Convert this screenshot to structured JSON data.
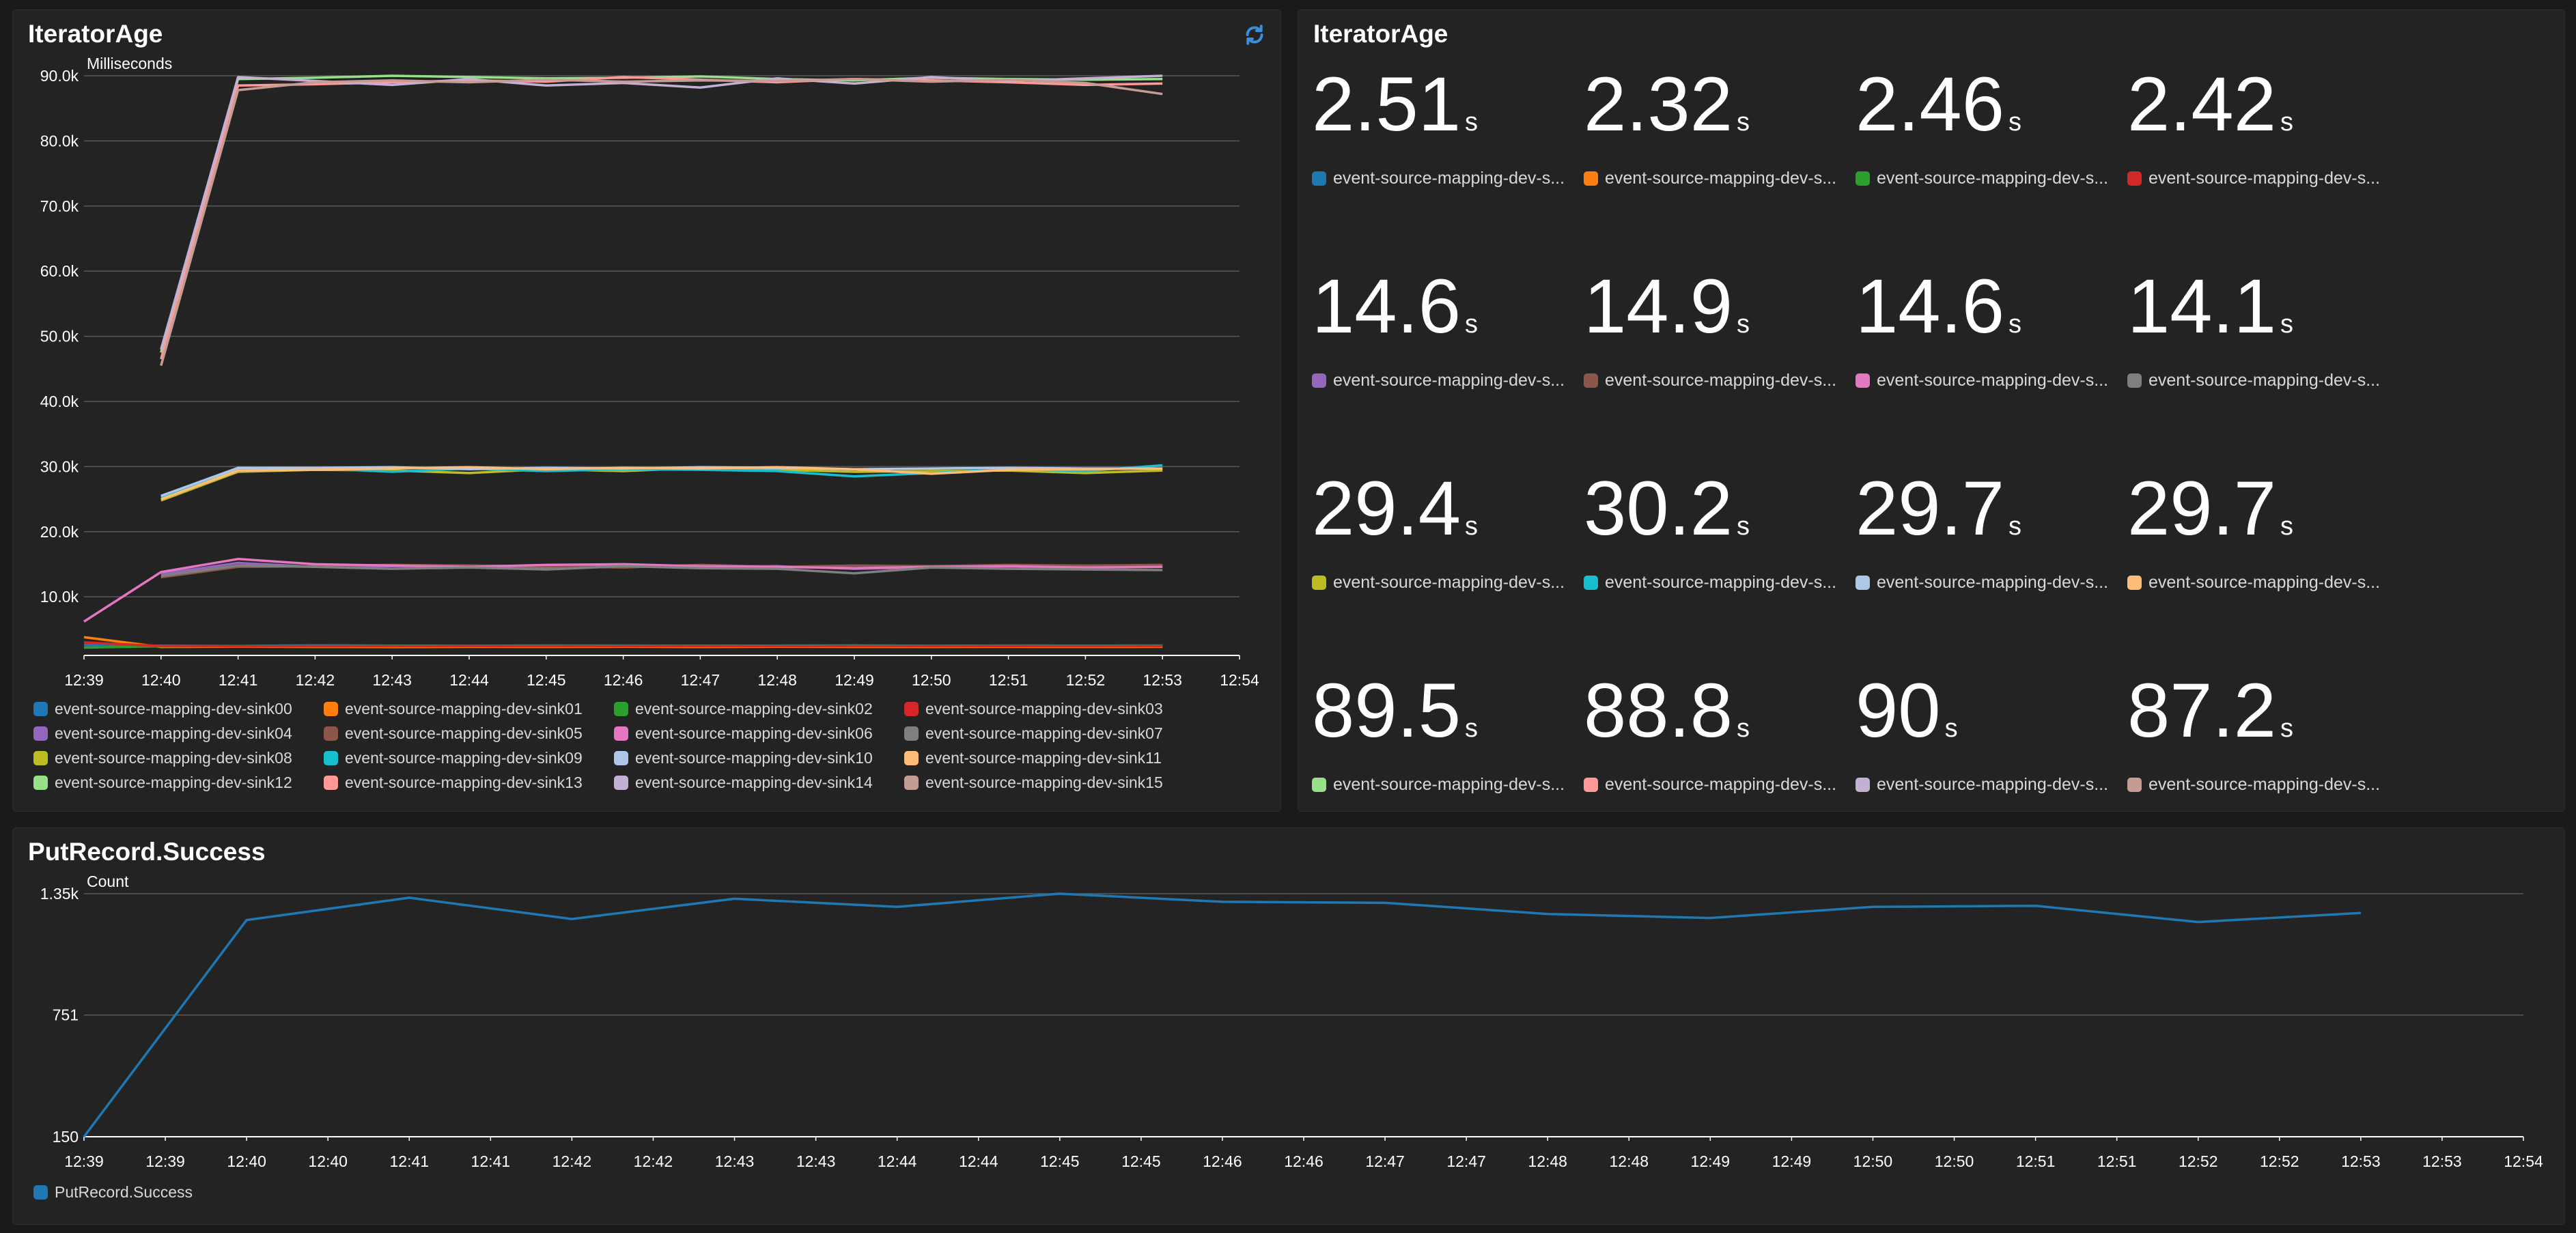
{
  "panels": {
    "iterator_chart": {
      "title": "IteratorAge",
      "refresh_icon": "refresh-icon"
    },
    "iterator_values": {
      "title": "IteratorAge"
    },
    "putrecord": {
      "title": "PutRecord.Success"
    }
  },
  "colors": {
    "background": "#1a1a1a",
    "panel": "#232323",
    "grid": "#5a5a5a",
    "accent": "#1f77b4"
  },
  "single_values": [
    {
      "value": "2.51",
      "unit": "s",
      "label": "event-source-mapping-dev-s...",
      "color": "#1f77b4"
    },
    {
      "value": "2.32",
      "unit": "s",
      "label": "event-source-mapping-dev-s...",
      "color": "#ff7f0e"
    },
    {
      "value": "2.46",
      "unit": "s",
      "label": "event-source-mapping-dev-s...",
      "color": "#2ca02c"
    },
    {
      "value": "2.42",
      "unit": "s",
      "label": "event-source-mapping-dev-s...",
      "color": "#d62728"
    },
    {
      "value": "14.6",
      "unit": "s",
      "label": "event-source-mapping-dev-s...",
      "color": "#9467bd"
    },
    {
      "value": "14.9",
      "unit": "s",
      "label": "event-source-mapping-dev-s...",
      "color": "#8c564b"
    },
    {
      "value": "14.6",
      "unit": "s",
      "label": "event-source-mapping-dev-s...",
      "color": "#e377c2"
    },
    {
      "value": "14.1",
      "unit": "s",
      "label": "event-source-mapping-dev-s...",
      "color": "#7f7f7f"
    },
    {
      "value": "29.4",
      "unit": "s",
      "label": "event-source-mapping-dev-s...",
      "color": "#bcbd22"
    },
    {
      "value": "30.2",
      "unit": "s",
      "label": "event-source-mapping-dev-s...",
      "color": "#17becf"
    },
    {
      "value": "29.7",
      "unit": "s",
      "label": "event-source-mapping-dev-s...",
      "color": "#aec7e8"
    },
    {
      "value": "29.7",
      "unit": "s",
      "label": "event-source-mapping-dev-s...",
      "color": "#ffbb78"
    },
    {
      "value": "89.5",
      "unit": "s",
      "label": "event-source-mapping-dev-s...",
      "color": "#98df8a"
    },
    {
      "value": "88.8",
      "unit": "s",
      "label": "event-source-mapping-dev-s...",
      "color": "#ff9896"
    },
    {
      "value": "90",
      "unit": "s",
      "label": "event-source-mapping-dev-s...",
      "color": "#c5b0d5"
    },
    {
      "value": "87.2",
      "unit": "s",
      "label": "event-source-mapping-dev-s...",
      "color": "#c49c94"
    }
  ],
  "chart_data": [
    {
      "type": "line",
      "title": "IteratorAge",
      "ylabel": "Milliseconds",
      "xlabel": "",
      "x": [
        "12:39",
        "12:40",
        "12:41",
        "12:42",
        "12:43",
        "12:44",
        "12:45",
        "12:46",
        "12:47",
        "12:48",
        "12:49",
        "12:50",
        "12:51",
        "12:52",
        "12:53",
        "12:54"
      ],
      "ylim": [
        1000,
        90000
      ],
      "yticks": [
        {
          "value": 10000,
          "label": "10.0k"
        },
        {
          "value": 20000,
          "label": "20.0k"
        },
        {
          "value": 30000,
          "label": "30.0k"
        },
        {
          "value": 40000,
          "label": "40.0k"
        },
        {
          "value": 50000,
          "label": "50.0k"
        },
        {
          "value": 60000,
          "label": "60.0k"
        },
        {
          "value": 70000,
          "label": "70.0k"
        },
        {
          "value": 80000,
          "label": "80.0k"
        },
        {
          "value": 90000,
          "label": "90.0k"
        }
      ],
      "grid": true,
      "legend_position": "bottom",
      "series": [
        {
          "name": "event-source-mapping-dev-sink00",
          "color": "#1f77b4",
          "start": 0,
          "values": [
            2600,
            2500,
            2450,
            2550,
            2500,
            2480,
            2520,
            2510,
            2490,
            2500,
            2530,
            2480,
            2510,
            2500,
            2510
          ]
        },
        {
          "name": "event-source-mapping-dev-sink01",
          "color": "#ff7f0e",
          "start": 0,
          "values": [
            3800,
            2300,
            2350,
            2300,
            2280,
            2320,
            2310,
            2330,
            2300,
            2340,
            2310,
            2300,
            2320,
            2310,
            2320
          ]
        },
        {
          "name": "event-source-mapping-dev-sink02",
          "color": "#2ca02c",
          "start": 0,
          "values": [
            2200,
            2400,
            2450,
            2400,
            2470,
            2440,
            2460,
            2450,
            2470,
            2440,
            2460,
            2450,
            2460,
            2450,
            2460
          ]
        },
        {
          "name": "event-source-mapping-dev-sink03",
          "color": "#d62728",
          "start": 0,
          "values": [
            3000,
            2450,
            2400,
            2420,
            2410,
            2430,
            2420,
            2410,
            2430,
            2420,
            2410,
            2420,
            2430,
            2420,
            2420
          ]
        },
        {
          "name": "event-source-mapping-dev-sink04",
          "color": "#9467bd",
          "start": 0,
          "values": [
            null,
            13500,
            15200,
            14600,
            14700,
            14800,
            14500,
            14900,
            14600,
            14700,
            14300,
            14500,
            14700,
            14600,
            14600
          ]
        },
        {
          "name": "event-source-mapping-dev-sink05",
          "color": "#8c564b",
          "start": 0,
          "values": [
            null,
            13000,
            14600,
            14700,
            14900,
            14800,
            14700,
            14500,
            14900,
            14600,
            14800,
            14700,
            14900,
            14800,
            14900
          ]
        },
        {
          "name": "event-source-mapping-dev-sink06",
          "color": "#e377c2",
          "start": 0,
          "values": [
            6200,
            13800,
            15800,
            15000,
            14800,
            14600,
            14900,
            15000,
            14700,
            14600,
            14400,
            14600,
            14700,
            14500,
            14600
          ]
        },
        {
          "name": "event-source-mapping-dev-sink07",
          "color": "#7f7f7f",
          "start": 0,
          "values": [
            null,
            13200,
            14800,
            14600,
            14300,
            14500,
            14200,
            14700,
            14400,
            14300,
            13600,
            14500,
            14300,
            14200,
            14100
          ]
        },
        {
          "name": "event-source-mapping-dev-sink08",
          "color": "#bcbd22",
          "start": 0,
          "values": [
            null,
            24800,
            29200,
            29500,
            29400,
            29000,
            29600,
            29300,
            29800,
            29500,
            29200,
            29300,
            29400,
            29000,
            29400
          ]
        },
        {
          "name": "event-source-mapping-dev-sink09",
          "color": "#17becf",
          "start": 0,
          "values": [
            null,
            25300,
            29600,
            29700,
            29200,
            29700,
            29300,
            29600,
            29500,
            29300,
            28500,
            29000,
            29600,
            29300,
            30200
          ]
        },
        {
          "name": "event-source-mapping-dev-sink10",
          "color": "#aec7e8",
          "start": 0,
          "values": [
            null,
            25500,
            29800,
            29800,
            29900,
            29600,
            29800,
            29700,
            29900,
            29800,
            29600,
            29700,
            29800,
            29700,
            29700
          ]
        },
        {
          "name": "event-source-mapping-dev-sink11",
          "color": "#ffbb78",
          "start": 0,
          "values": [
            null,
            25000,
            29400,
            29500,
            29700,
            29900,
            29600,
            29800,
            29700,
            29900,
            29600,
            28900,
            29500,
            29600,
            29700
          ]
        },
        {
          "name": "event-source-mapping-dev-sink12",
          "color": "#98df8a",
          "start": 0,
          "values": [
            null,
            47500,
            89500,
            89700,
            90000,
            89800,
            89600,
            89700,
            89900,
            89500,
            89300,
            89700,
            89500,
            89400,
            89500
          ]
        },
        {
          "name": "event-source-mapping-dev-sink13",
          "color": "#ff9896",
          "start": 0,
          "values": [
            null,
            46500,
            88500,
            88700,
            89000,
            89300,
            89100,
            89800,
            89400,
            89000,
            89500,
            89300,
            89000,
            88600,
            88800
          ]
        },
        {
          "name": "event-source-mapping-dev-sink14",
          "color": "#c5b0d5",
          "start": 0,
          "values": [
            null,
            48000,
            89800,
            89200,
            88600,
            89500,
            88500,
            88900,
            88200,
            89600,
            88800,
            89800,
            89200,
            89600,
            90000
          ]
        },
        {
          "name": "event-source-mapping-dev-sink15",
          "color": "#c49c94",
          "start": 0,
          "values": [
            null,
            45500,
            87800,
            89000,
            89300,
            89000,
            89400,
            89100,
            89300,
            89200,
            89500,
            89100,
            89400,
            88900,
            87200
          ]
        }
      ]
    },
    {
      "type": "line",
      "title": "PutRecord.Success",
      "ylabel": "Count",
      "xlabel": "",
      "x": [
        "12:39",
        "12:39",
        "12:40",
        "12:40",
        "12:41",
        "12:41",
        "12:42",
        "12:42",
        "12:43",
        "12:43",
        "12:44",
        "12:44",
        "12:45",
        "12:45",
        "12:46",
        "12:46",
        "12:47",
        "12:47",
        "12:48",
        "12:48",
        "12:49",
        "12:49",
        "12:50",
        "12:50",
        "12:51",
        "12:51",
        "12:52",
        "12:52",
        "12:53",
        "12:53",
        "12:54"
      ],
      "ylim": [
        150,
        1350
      ],
      "yticks": [
        {
          "value": 150,
          "label": "150"
        },
        {
          "value": 751,
          "label": "751"
        },
        {
          "value": 1350,
          "label": "1.35k"
        }
      ],
      "grid": true,
      "legend_position": "bottom-left",
      "series": [
        {
          "name": "PutRecord.Success",
          "color": "#1f77b4",
          "start": 0,
          "values": [
            150,
            null,
            1220,
            null,
            1330,
            null,
            1225,
            null,
            1325,
            null,
            1285,
            null,
            1350,
            null,
            1310,
            null,
            1305,
            null,
            1250,
            null,
            1230,
            null,
            1285,
            null,
            1290,
            null,
            1210,
            null,
            1255
          ]
        }
      ]
    }
  ]
}
